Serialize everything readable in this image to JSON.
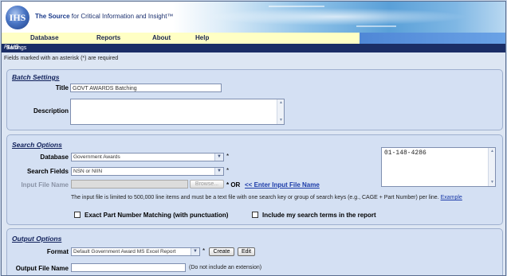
{
  "header": {
    "logo_text": "IHS",
    "tagline_brand": "The Source",
    "tagline_rest": " for Critical Information and Insight™"
  },
  "menu": {
    "items": [
      "Database",
      "Reports",
      "About",
      "Help"
    ]
  },
  "subtitle": {
    "prefix": "Batch",
    "italic": "PLUS",
    "suffix": " Settings"
  },
  "required_note": "Fields marked with an asterisk (*) are required",
  "batch_settings": {
    "title": "Batch Settings",
    "title_label": "Title",
    "title_value": "GOVT AWARDS Batching",
    "description_label": "Description",
    "description_value": ""
  },
  "search_options": {
    "title": "Search Options",
    "database_label": "Database",
    "database_value": "Government Awards",
    "search_fields_label": "Search Fields",
    "search_fields_value": "NSN or NIIN",
    "input_file_label": "Input File Name",
    "browse_label": "Browse...",
    "asterisk": "*",
    "or_label": "* OR",
    "enter_input_link": "<< Enter Input File Name",
    "note": "The input file is limited to 500,000 line items and must be a text file with one search key or group of search keys (e.g., CAGE + Part Number) per line.",
    "example_link": "Example",
    "exact_match_label": "Exact Part Number Matching (with punctuation)",
    "exact_match_checked": false,
    "include_terms_label": "Include my search terms in the report",
    "include_terms_checked": false,
    "search_keys_value": "01-148-4286"
  },
  "output_options": {
    "title": "Output Options",
    "format_label": "Format",
    "format_value": "Default Government Award MS Excel Report",
    "create_label": "Create",
    "edit_label": "Edit",
    "output_file_label": "Output File Name",
    "output_file_value": "",
    "output_hint": "(Do not include an extension)"
  }
}
